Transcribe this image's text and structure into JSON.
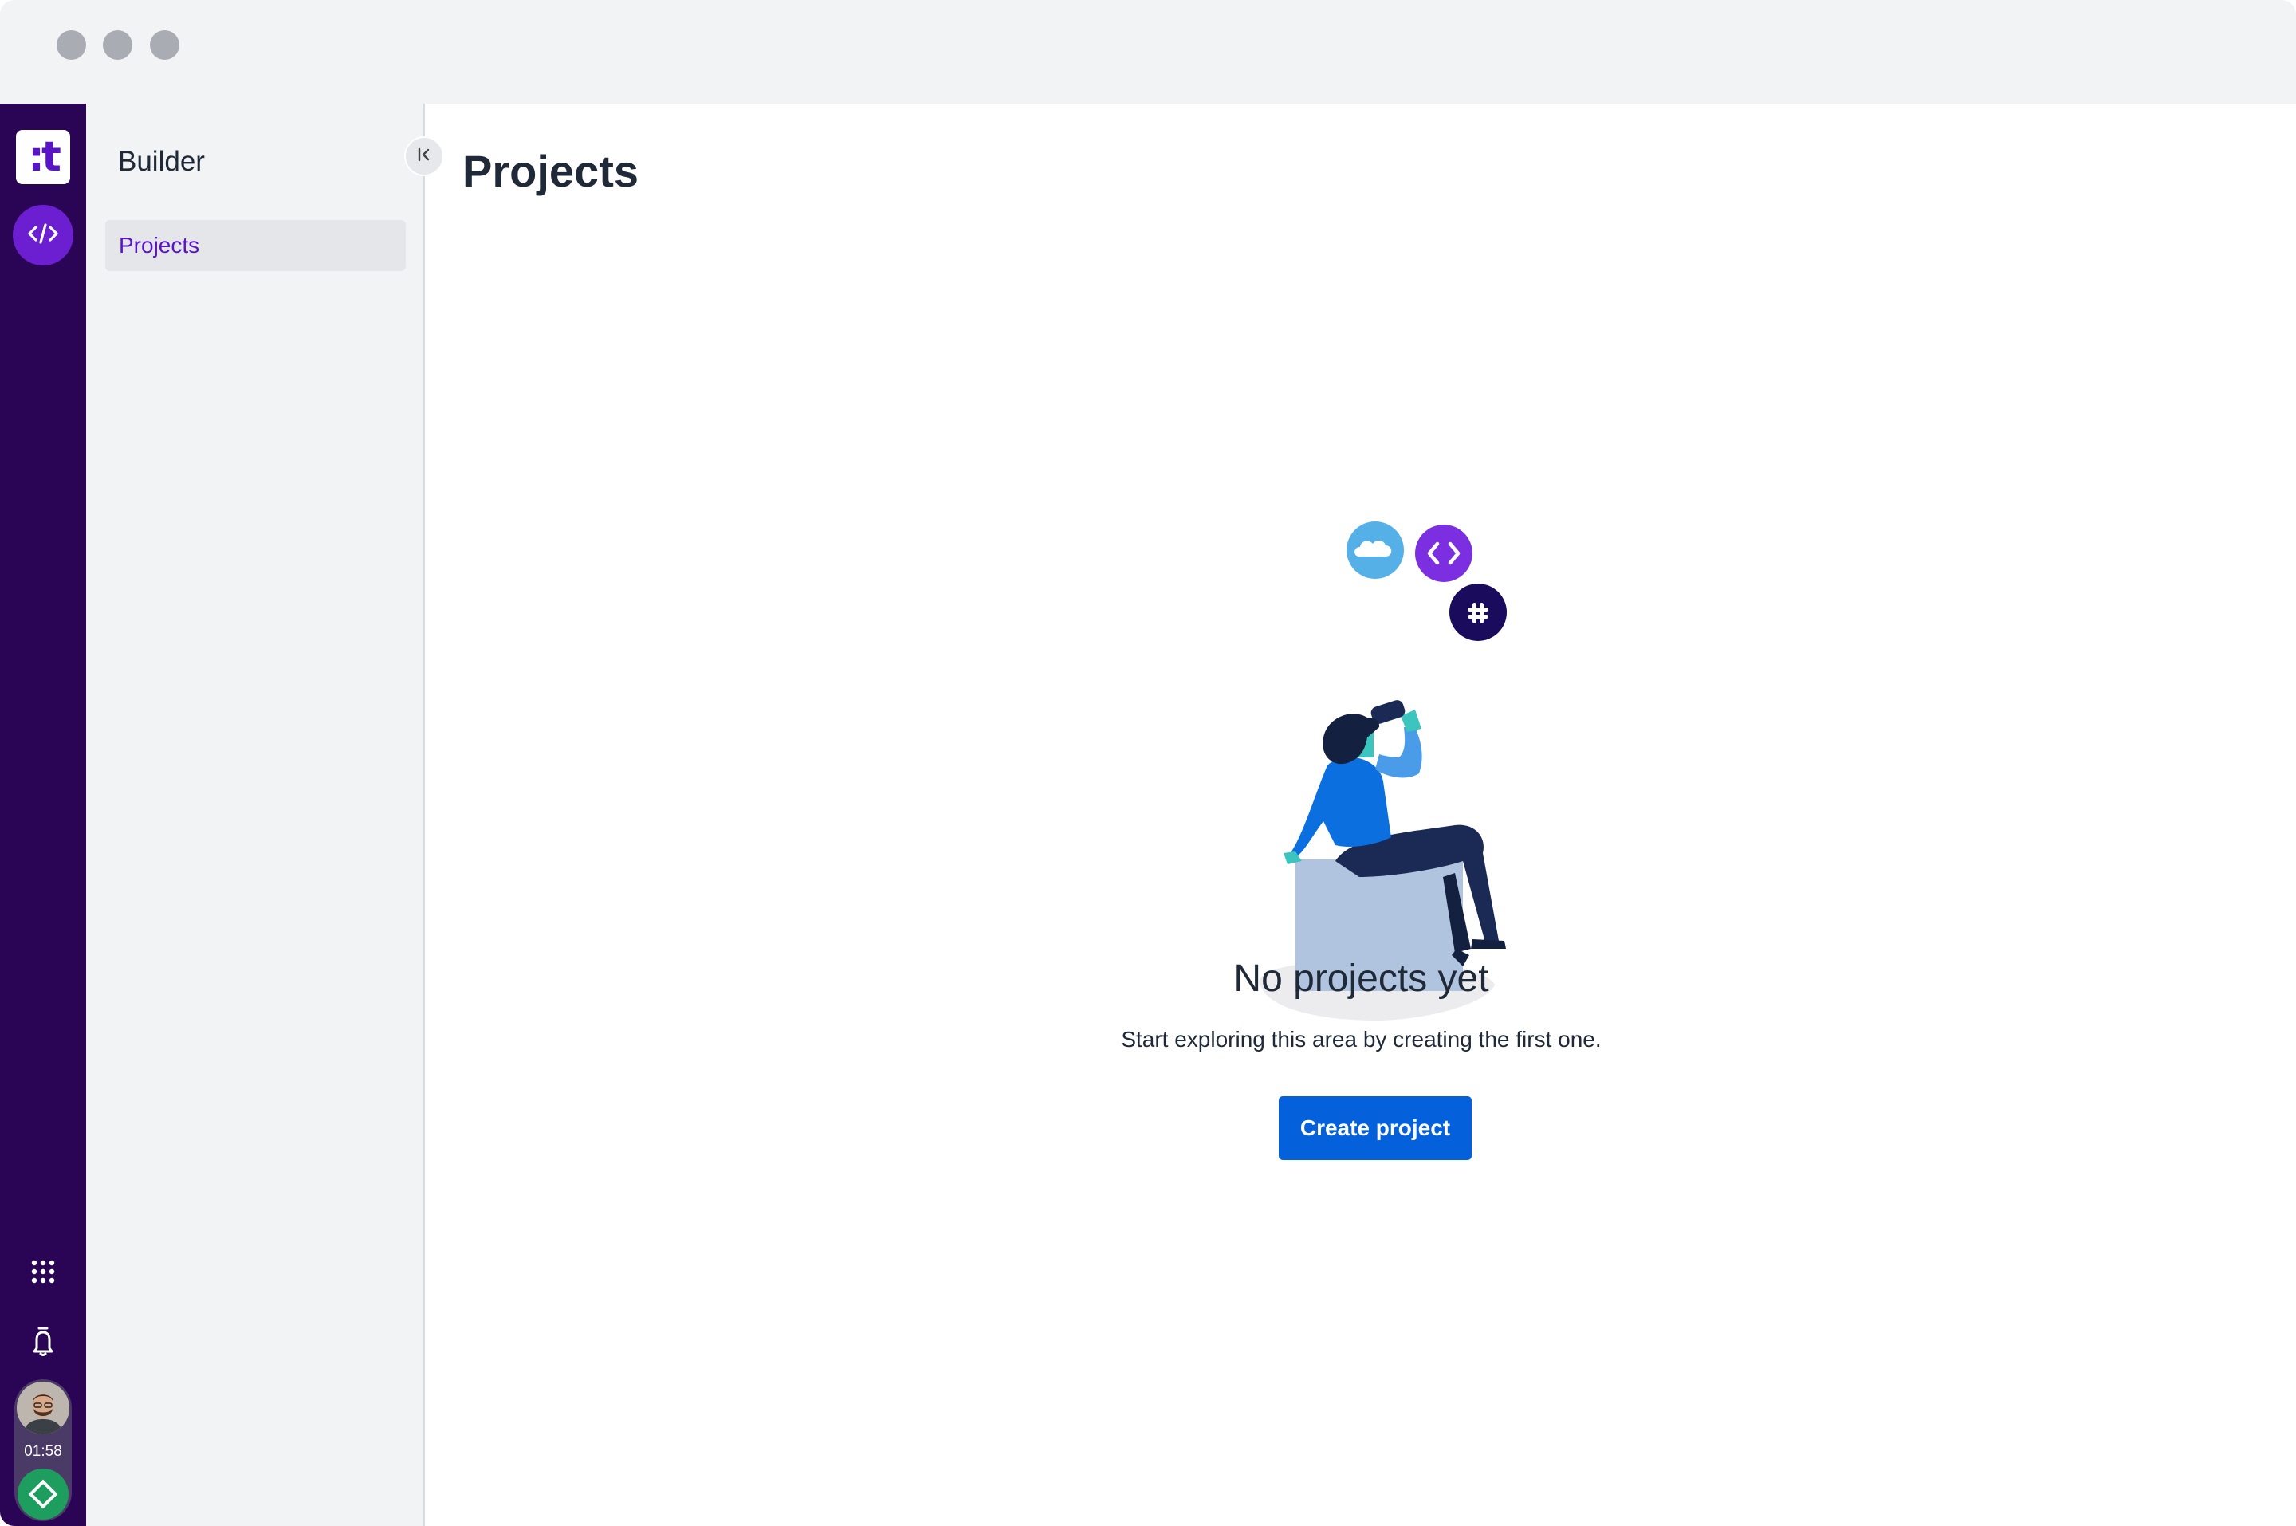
{
  "sidebar": {
    "title": "Builder",
    "items": [
      {
        "label": "Projects",
        "active": true
      }
    ]
  },
  "main": {
    "title": "Projects",
    "empty_state": {
      "title": "No projects yet",
      "subtitle": "Start exploring this area by creating the first one.",
      "button_label": "Create project",
      "illustration_icons": [
        "salesforce-icon",
        "code-icon",
        "slack-icon"
      ]
    }
  },
  "rail": {
    "logo_text": ":t",
    "items": [
      "code-icon",
      "apps-grid-icon",
      "bell-icon"
    ],
    "user": {
      "timer": "01:58",
      "status": "online"
    }
  },
  "colors": {
    "rail_bg": "#2a0556",
    "accent_purple": "#6c1fd1",
    "brand_purple": "#5a14c8",
    "primary_button": "#0461db",
    "sidebar_bg": "#f2f3f5",
    "status_green": "#1e9e5e"
  }
}
